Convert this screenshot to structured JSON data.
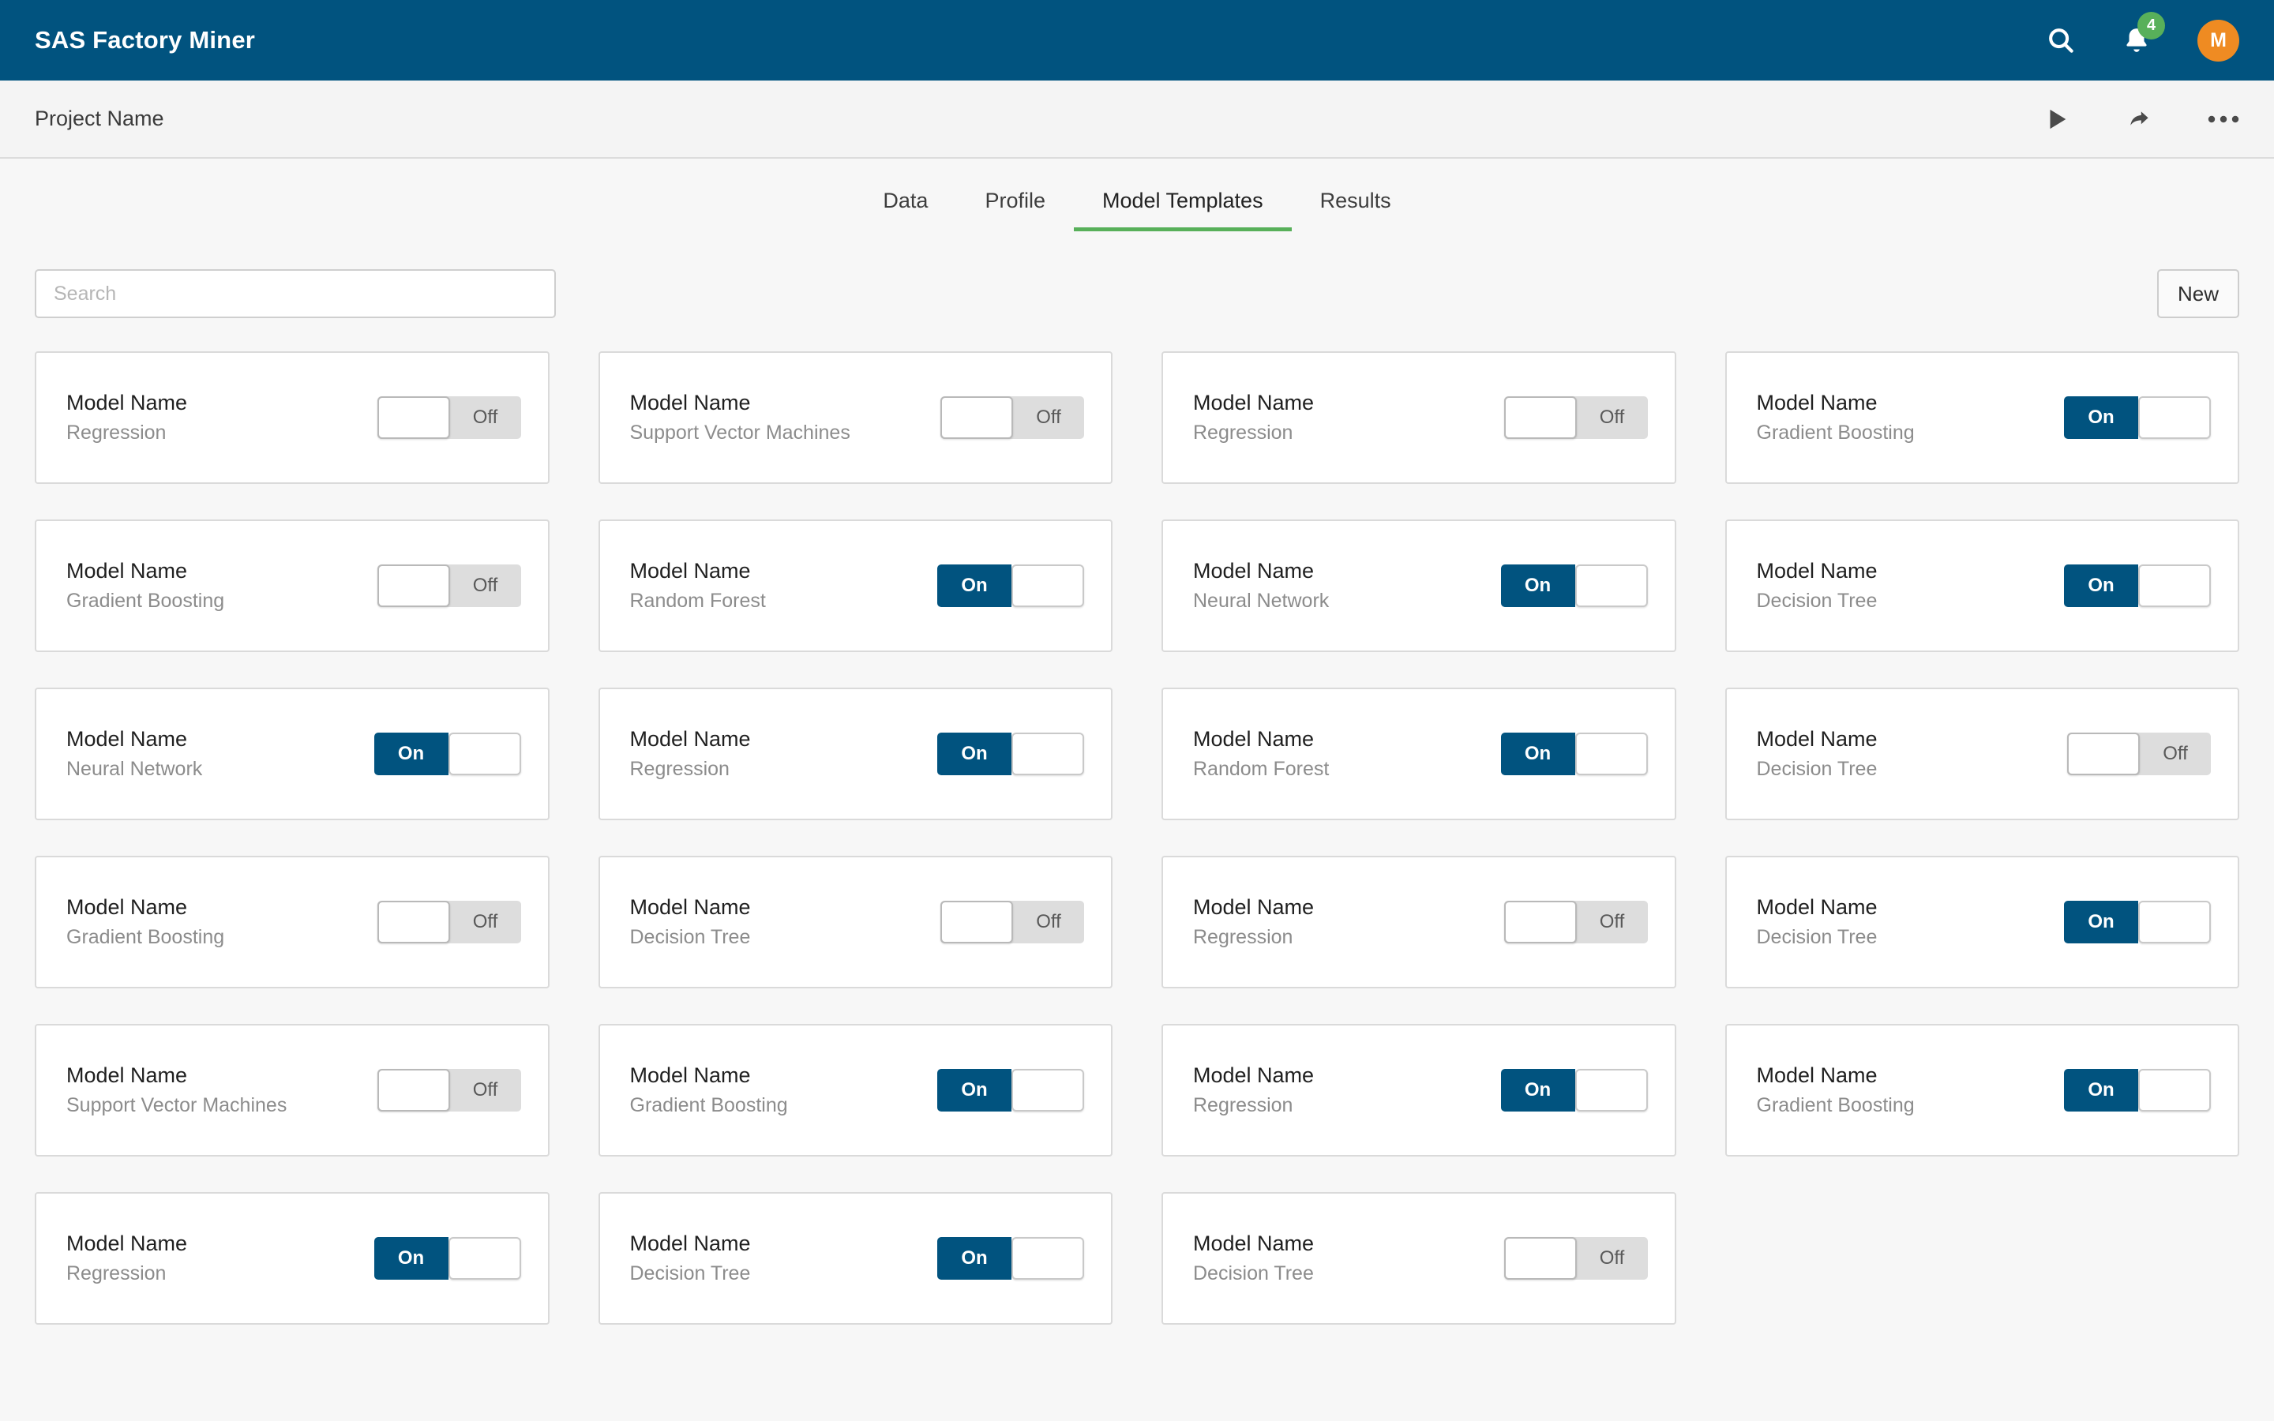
{
  "appbar": {
    "title": "SAS Factory Miner",
    "search_icon": "search-icon",
    "notifications_icon": "bell-icon",
    "notifications_count": "4",
    "avatar_initial": "M"
  },
  "projectbar": {
    "name": "Project Name",
    "run_icon": "play-icon",
    "share_icon": "share-arrow-icon",
    "more_icon": "ellipsis-icon"
  },
  "tabs": [
    {
      "label": "Data",
      "active": false
    },
    {
      "label": "Profile",
      "active": false
    },
    {
      "label": "Model Templates",
      "active": true
    },
    {
      "label": "Results",
      "active": false
    }
  ],
  "toolbar": {
    "search_value": "",
    "search_placeholder": "Search",
    "new_label": "New"
  },
  "colors": {
    "header_blue": "#01537f",
    "accent_green": "#58b05a",
    "avatar_orange": "#ef8b22",
    "toggle_on_blue": "#01537f",
    "toggle_off_gray": "#dddddd"
  },
  "toggle_labels": {
    "on": "On",
    "off": "Off"
  },
  "cards": [
    {
      "title": "Model Name",
      "subtitle": "Regression",
      "state": "off"
    },
    {
      "title": "Model Name",
      "subtitle": "Support Vector Machines",
      "state": "off"
    },
    {
      "title": "Model Name",
      "subtitle": "Regression",
      "state": "off"
    },
    {
      "title": "Model Name",
      "subtitle": "Gradient Boosting",
      "state": "on"
    },
    {
      "title": "Model Name",
      "subtitle": "Gradient Boosting",
      "state": "off"
    },
    {
      "title": "Model Name",
      "subtitle": "Random Forest",
      "state": "on"
    },
    {
      "title": "Model Name",
      "subtitle": "Neural Network",
      "state": "on"
    },
    {
      "title": "Model Name",
      "subtitle": "Decision Tree",
      "state": "on"
    },
    {
      "title": "Model Name",
      "subtitle": "Neural Network",
      "state": "on"
    },
    {
      "title": "Model Name",
      "subtitle": "Regression",
      "state": "on"
    },
    {
      "title": "Model Name",
      "subtitle": "Random Forest",
      "state": "on"
    },
    {
      "title": "Model Name",
      "subtitle": "Decision Tree",
      "state": "off"
    },
    {
      "title": "Model Name",
      "subtitle": "Gradient Boosting",
      "state": "off"
    },
    {
      "title": "Model Name",
      "subtitle": "Decision Tree",
      "state": "off"
    },
    {
      "title": "Model Name",
      "subtitle": "Regression",
      "state": "off"
    },
    {
      "title": "Model Name",
      "subtitle": "Decision Tree",
      "state": "on"
    },
    {
      "title": "Model Name",
      "subtitle": "Support Vector Machines",
      "state": "off"
    },
    {
      "title": "Model Name",
      "subtitle": "Gradient Boosting",
      "state": "on"
    },
    {
      "title": "Model Name",
      "subtitle": "Regression",
      "state": "on"
    },
    {
      "title": "Model Name",
      "subtitle": "Gradient Boosting",
      "state": "on"
    },
    {
      "title": "Model Name",
      "subtitle": "Regression",
      "state": "on"
    },
    {
      "title": "Model Name",
      "subtitle": "Decision Tree",
      "state": "on"
    },
    {
      "title": "Model Name",
      "subtitle": "Decision Tree",
      "state": "off"
    }
  ]
}
